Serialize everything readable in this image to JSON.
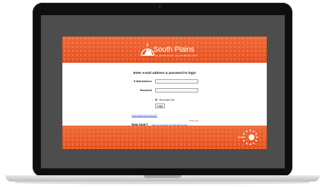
{
  "brand": {
    "name": "South Plains",
    "subtitle": "TELEPHONE COOPERATIVE"
  },
  "login": {
    "heading": "Enter e-mail address & password to login",
    "email_label": "E-Mail Address",
    "email_value": "",
    "password_label": "Password",
    "password_value": "",
    "remember_label": "Remember Me",
    "remember_checked": false,
    "login_button": "Login",
    "cant_access_link": "Can't access your account?",
    "new_user_label": "New User?",
    "signup_link": "Sign up to access our Self Service site.",
    "version": "Version 22.4"
  },
  "footer": {
    "logo_text": "smart"
  },
  "colors": {
    "banner_orange": "#e95a2b",
    "laptop_bezel": "#0e0e0e",
    "screen_gray": "#4d4d4d",
    "link_blue": "#1a3cc4"
  }
}
